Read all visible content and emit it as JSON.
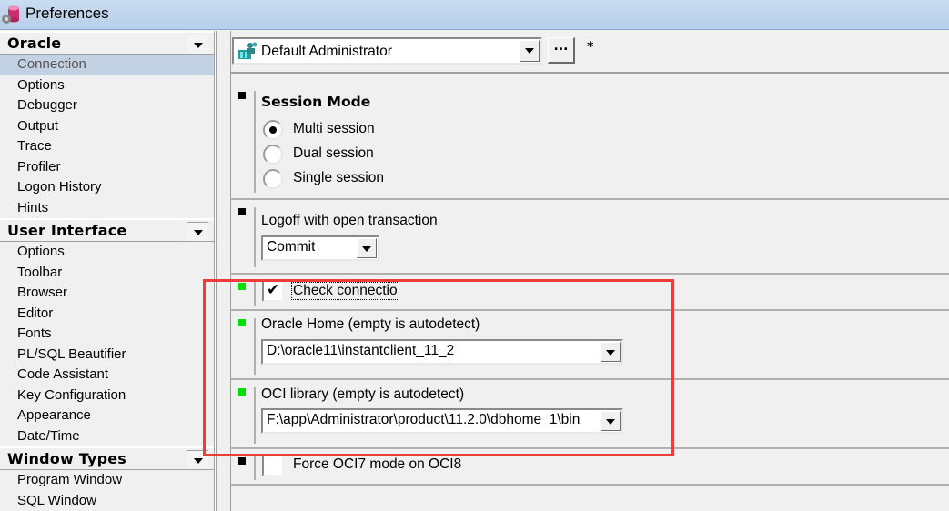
{
  "window": {
    "title": "Preferences",
    "app_icon": "database-gear-icon"
  },
  "sidebar": {
    "groups": [
      {
        "label": "Oracle",
        "items": [
          {
            "label": "Connection",
            "selected": true
          },
          {
            "label": "Options"
          },
          {
            "label": "Debugger"
          },
          {
            "label": "Output"
          },
          {
            "label": "Trace"
          },
          {
            "label": "Profiler"
          },
          {
            "label": "Logon History"
          },
          {
            "label": "Hints"
          }
        ]
      },
      {
        "label": "User Interface",
        "items": [
          {
            "label": "Options"
          },
          {
            "label": "Toolbar"
          },
          {
            "label": "Browser"
          },
          {
            "label": "Editor"
          },
          {
            "label": "Fonts"
          },
          {
            "label": "PL/SQL Beautifier"
          },
          {
            "label": "Code Assistant"
          },
          {
            "label": "Key Configuration"
          },
          {
            "label": "Appearance"
          },
          {
            "label": "Date/Time"
          }
        ]
      },
      {
        "label": "Window Types",
        "items": [
          {
            "label": "Program Window"
          },
          {
            "label": "SQL Window"
          }
        ]
      }
    ]
  },
  "main": {
    "profile": {
      "value": "Default Administrator",
      "icon": "user-group-icon",
      "ellipsis_label": "...",
      "modified_mark": "*"
    },
    "session_mode": {
      "title": "Session Mode",
      "marker_color": "#000000",
      "options": [
        {
          "label": "Multi session",
          "checked": true
        },
        {
          "label": "Dual session",
          "checked": false
        },
        {
          "label": "Single session",
          "checked": false
        }
      ]
    },
    "logoff": {
      "label": "Logoff with open transaction",
      "value": "Commit",
      "marker_color": "#000000"
    },
    "check_connection": {
      "label": "Check connectio",
      "checked": true,
      "marker_color": "#00e000"
    },
    "oracle_home": {
      "label": "Oracle Home (empty is autodetect)",
      "value": "D:\\oracle11\\instantclient_11_2",
      "marker_color": "#00e000"
    },
    "oci_library": {
      "label": "OCI library (empty is autodetect)",
      "value": "F:\\app\\Administrator\\product\\11.2.0\\dbhome_1\\bin",
      "marker_color": "#00e000"
    },
    "force_oci7": {
      "label": "Force OCI7 mode on OCI8",
      "checked": false,
      "marker_color": "#000000"
    }
  },
  "annotation": {
    "color": "#ee3b3b"
  }
}
